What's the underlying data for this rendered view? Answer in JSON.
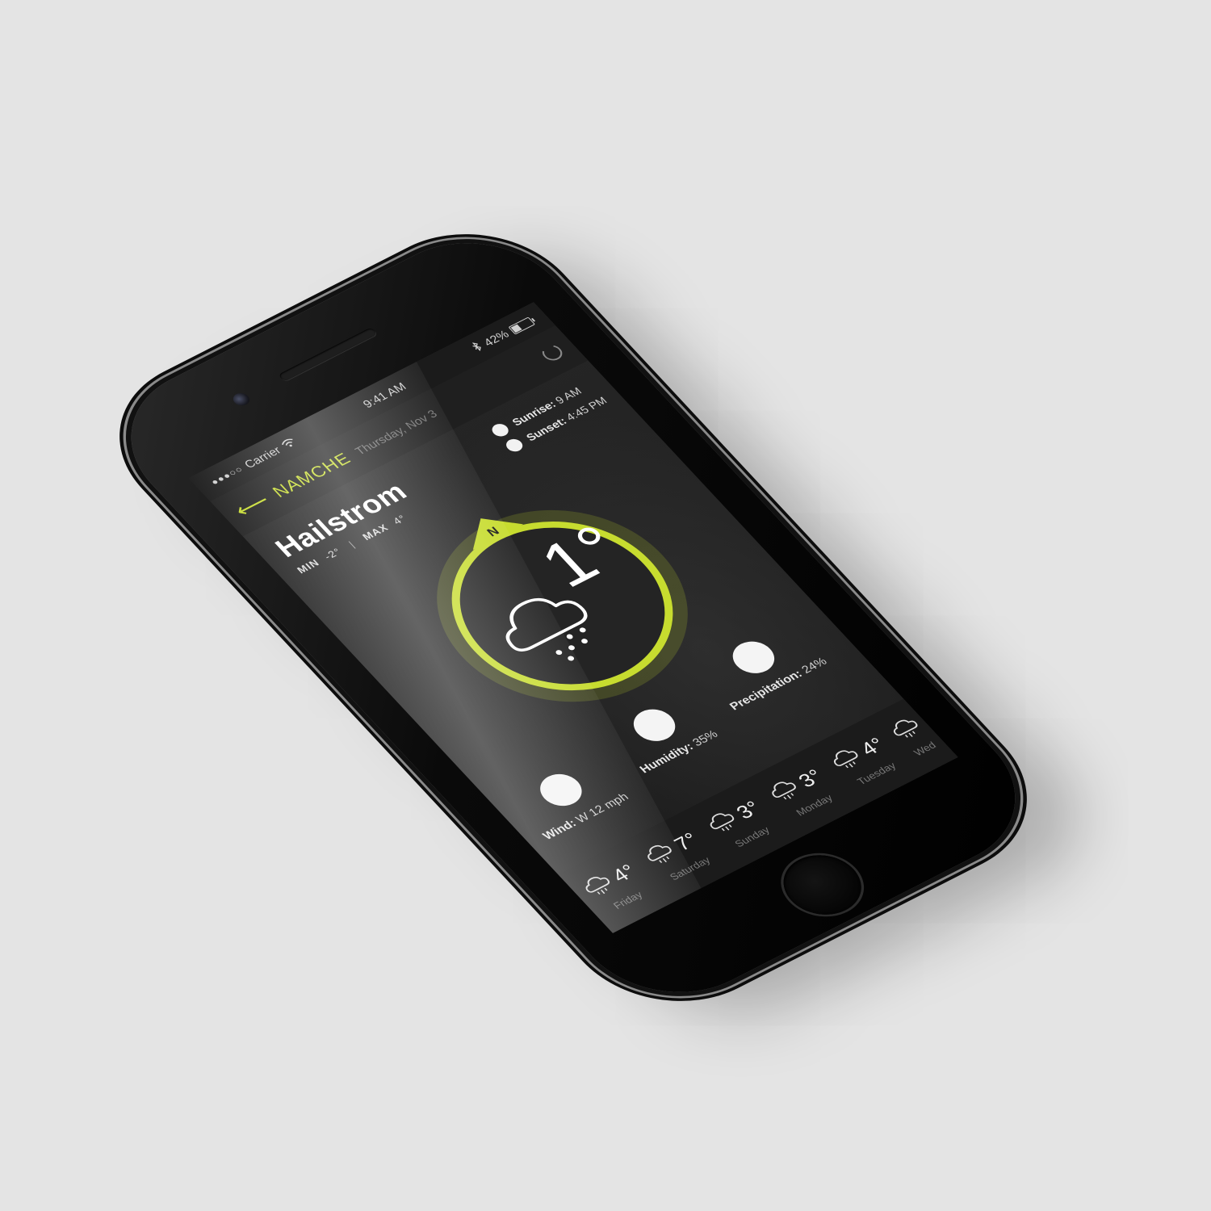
{
  "status_bar": {
    "carrier": "Carrier",
    "time": "9:41 AM",
    "battery": "42%",
    "battery_level": 0.42,
    "signal_icon": "signal-dots-icon",
    "wifi_icon": "wifi-icon",
    "bluetooth_icon": "bluetooth-icon"
  },
  "header": {
    "city": "NAMCHE",
    "date": "Thursday, Nov 3",
    "back_icon": "back-arrow-icon",
    "refresh_icon": "refresh-icon"
  },
  "current": {
    "condition": "Hailstrom",
    "min_label": "MIN",
    "min_value": "-2°",
    "separator": "|",
    "max_label": "MAX",
    "max_value": "4°",
    "temperature": "1°",
    "compass_letter": "N",
    "icon": "hail-cloud-icon"
  },
  "sun": {
    "sunrise_label": "Sunrise:",
    "sunrise_value": "9 AM",
    "sunset_label": "Sunset:",
    "sunset_value": "4:45 PM"
  },
  "stats": {
    "wind_label": "Wind:",
    "wind_value": "W 12 mph",
    "humidity_label": "Humidity:",
    "humidity_value": "35%",
    "precipitation_label": "Precipitation:",
    "precipitation_value": "24%"
  },
  "forecast": [
    {
      "day": "Friday",
      "temp": "4°",
      "icon": "rain-cloud-icon"
    },
    {
      "day": "Saturday",
      "temp": "7°",
      "icon": "rain-cloud-icon"
    },
    {
      "day": "Sunday",
      "temp": "3°",
      "icon": "rain-cloud-icon"
    },
    {
      "day": "Monday",
      "temp": "3°",
      "icon": "rain-cloud-icon"
    },
    {
      "day": "Tuesday",
      "temp": "4°",
      "icon": "rain-cloud-icon"
    },
    {
      "day": "Wed",
      "temp": "",
      "icon": "rain-cloud-icon"
    }
  ],
  "colors": {
    "accent": "#c7dc2f",
    "background": "#e4e4e4",
    "screen": "#222222"
  }
}
